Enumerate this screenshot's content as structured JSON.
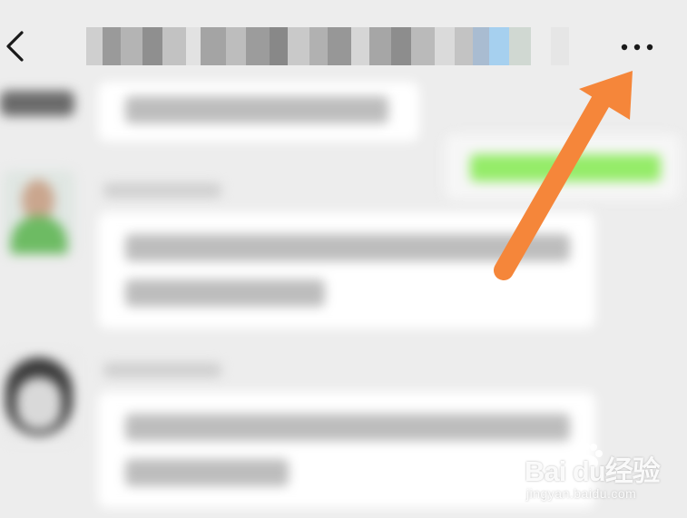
{
  "header": {
    "back_icon": "chevron-left-icon",
    "title": "",
    "more_icon": "more-dots-icon"
  },
  "watermark": {
    "brand": "Bai du",
    "brand_cn": "经验",
    "url": "jingyan.baidu.com"
  },
  "colors": {
    "background": "#ededed",
    "bubble": "#ffffff",
    "green_bubble": "#95ec69",
    "arrow": "#f5863a"
  }
}
